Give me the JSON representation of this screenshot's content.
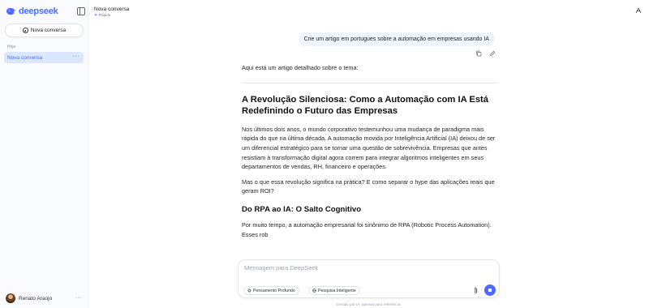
{
  "sidebar": {
    "logo_text": "deepseek",
    "new_chat_label": "Nova conversa",
    "section_label": "Hoje",
    "conversations": [
      {
        "label": "Nova conversa"
      }
    ],
    "user_name": "Renato Araújo",
    "more_glyph": "···"
  },
  "header": {
    "title": "Nova conversa",
    "model_label": "Rápido",
    "model_icon": "sparkle-icon",
    "share_icon": "share-icon"
  },
  "chat": {
    "user_message": "Crie um artigo em portugues sobre a automação em empresas usando IA",
    "message_actions": [
      "copy-icon",
      "edit-icon"
    ],
    "answer": {
      "intro": "Aqui está um artigo detalhado sobre o tema:",
      "heading": "A Revolução Silenciosa: Como a Automação com IA Está Redefinindo o Futuro das Empresas",
      "paragraph1": "Nos últimos dois anos, o mundo corporativo testemunhou uma mudança de paradigma mais rápida do que na última década. A automação movida por Inteligência Artificial (IA) deixou de ser um diferencial estratégico para se tornar uma questão de sobrevivência. Empresas que antes resistiam à transformação digital agora correm para integrar algoritmos inteligentes em seus departamentos de vendas, RH, financeiro e operações.",
      "paragraph2": "Mas o que essa revolução significa na prática? E como separar o hype das aplicações reais que geram ROI?",
      "subheading": "Do RPA ao IA: O Salto Cognitivo",
      "paragraph3": "Por muito tempo, a automação empresarial foi sinônimo de RPA (Robotic Process Automation). Esses rob"
    }
  },
  "composer": {
    "placeholder": "Mensagem para DeepSeek",
    "deep_think_label": "Pensamento Profundo",
    "search_label": "Pesquisa Inteligente",
    "disclaimer": "Gerado por IA, apenas para referência."
  },
  "colors": {
    "accent": "#4d6bfe",
    "sidebar_bg": "#f9fbff",
    "active_item_bg": "#dbe7ff",
    "user_bubble_bg": "#eff6ff"
  }
}
